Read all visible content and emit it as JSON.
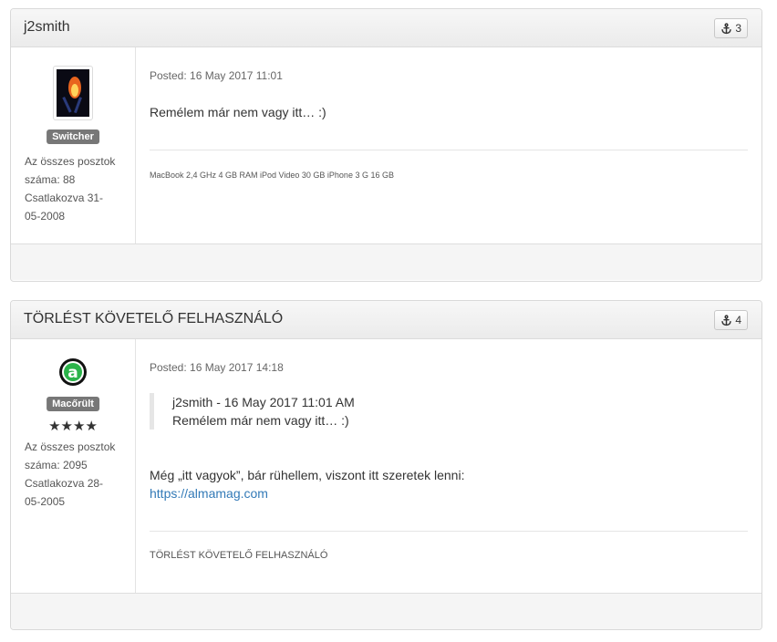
{
  "posts": [
    {
      "author": "j2smith",
      "anchor_count": "3",
      "rank": "Switcher",
      "stats_line1": "Az összes posztok",
      "stats_line2": "száma:  88",
      "stats_line3": "Csatlakozva  31-",
      "stats_line4": "05-2008",
      "posted": "Posted: 16 May 2017 11:01",
      "message": "Remélem már nem vagy itt… :)",
      "signature": "MacBook 2,4 GHz 4 GB RAM iPod Video 30 GB iPhone 3 G 16 GB"
    },
    {
      "author": "TÖRLÉST KÖVETELŐ FELHASZNÁLÓ",
      "anchor_count": "4",
      "rank": "Macőrült",
      "stars": "★★★★",
      "stats_line1": "Az összes posztok",
      "stats_line2": "száma:  2095",
      "stats_line3": "Csatlakozva  28-",
      "stats_line4": "05-2005",
      "posted": "Posted: 16 May 2017 14:18",
      "quote_header": "j2smith - 16 May 2017 11:01 AM",
      "quote_text": "Remélem már nem vagy itt… :)",
      "message": "Még „itt vagyok”, bár rühellem, viszont itt szeretek lenni:",
      "link": "https://almamag.com",
      "signature": "TÖRLÉST KÖVETELŐ FELHASZNÁLÓ"
    }
  ],
  "icons": {
    "anchor": "anchor-icon",
    "avatar1": "match-flame-avatar",
    "avatar2": "letter-a-avatar"
  }
}
